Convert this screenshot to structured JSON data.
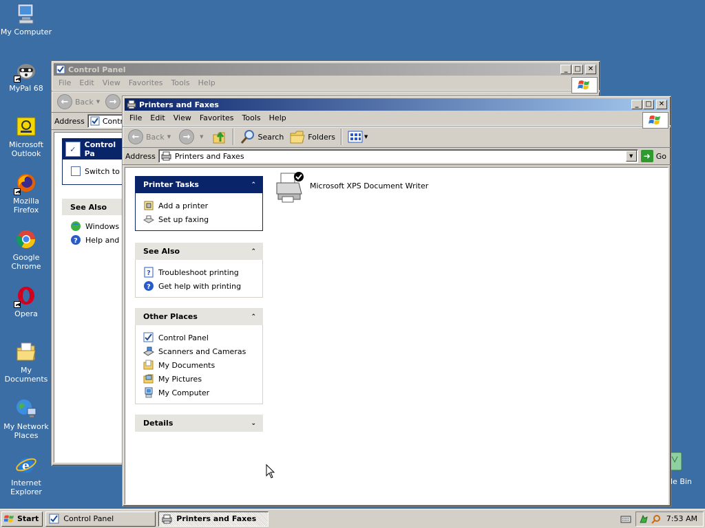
{
  "desktop": {
    "icons": [
      {
        "label": "My Computer",
        "icon": "my-computer-icon"
      },
      {
        "label": "MyPal 68",
        "icon": "mypal-raccoon-icon"
      },
      {
        "label": "Microsoft Outlook",
        "icon": "outlook-icon"
      },
      {
        "label": "Mozilla Firefox",
        "icon": "firefox-icon"
      },
      {
        "label": "Google Chrome",
        "icon": "chrome-icon"
      },
      {
        "label": "Opera",
        "icon": "opera-icon"
      },
      {
        "label": "My Documents",
        "icon": "my-documents-icon"
      },
      {
        "label": "My Network Places",
        "icon": "network-places-icon"
      },
      {
        "label": "Internet Explorer",
        "icon": "internet-explorer-icon"
      }
    ],
    "recycle_bin_label_partial": "le Bin"
  },
  "bg_window": {
    "title": "Control Panel",
    "menu": [
      "File",
      "Edit",
      "View",
      "Favorites",
      "Tools",
      "Help"
    ],
    "back_label": "Back",
    "address_label": "Address",
    "address_value": "Contro",
    "pane_title": "Control Pa",
    "pane_link": "Switch to C",
    "see_also_title": "See Also",
    "see_also_items": [
      "Windows U",
      "Help and S"
    ]
  },
  "main_window": {
    "title": "Printers and Faxes",
    "menu": [
      "File",
      "Edit",
      "View",
      "Favorites",
      "Tools",
      "Help"
    ],
    "toolbar": {
      "back_label": "Back",
      "search_label": "Search",
      "folders_label": "Folders"
    },
    "address_label": "Address",
    "address_value": "Printers and Faxes",
    "go_label": "Go",
    "panes": {
      "printer_tasks": {
        "title": "Printer Tasks",
        "items": [
          "Add a printer",
          "Set up faxing"
        ]
      },
      "see_also": {
        "title": "See Also",
        "items": [
          "Troubleshoot printing",
          "Get help with printing"
        ]
      },
      "other_places": {
        "title": "Other Places",
        "items": [
          "Control Panel",
          "Scanners and Cameras",
          "My Documents",
          "My Pictures",
          "My Computer"
        ]
      },
      "details": {
        "title": "Details"
      }
    },
    "printers": [
      {
        "name": "Microsoft XPS Document Writer",
        "default": true
      }
    ]
  },
  "taskbar": {
    "start_label": "Start",
    "tasks": [
      {
        "label": "Control Panel",
        "active": false
      },
      {
        "label": "Printers and Faxes",
        "active": true
      }
    ],
    "clock": "7:53 AM"
  },
  "colors": {
    "desktop": "#3a6ea5",
    "title_active": "#0a246a",
    "chrome": "#d4d0c8"
  }
}
